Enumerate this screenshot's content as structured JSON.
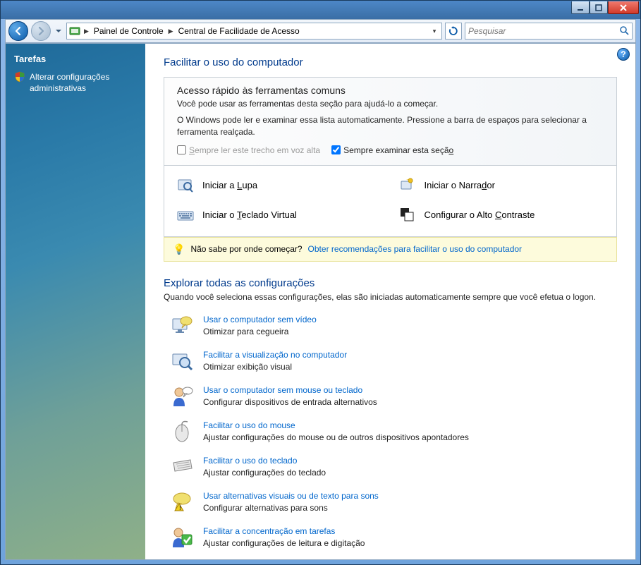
{
  "window": {
    "min_tip": "Minimizar",
    "max_tip": "Maximizar",
    "close_tip": "Fechar"
  },
  "nav": {
    "breadcrumb": {
      "root": "Painel de Controle",
      "current": "Central de Facilidade de Acesso"
    },
    "search_placeholder": "Pesquisar"
  },
  "sidebar": {
    "tasks_header": "Tarefas",
    "task1": "Alterar configurações administrativas"
  },
  "page": {
    "title": "Facilitar o uso do computador",
    "quick": {
      "title": "Acesso rápido às ferramentas comuns",
      "sub": "Você pode usar as ferramentas desta seção para ajudá-lo a começar.",
      "note": "O Windows pode ler e examinar essa lista automaticamente. Pressione a barra de espaços para selecionar a ferramenta realçada.",
      "chk_read_html": "<u>S</u>empre ler este trecho em voz alta",
      "chk_scan_html": "Sempre examinar esta seçã<u>o</u>"
    },
    "tools": {
      "magnifier_html": "Iniciar a <u>L</u>upa",
      "narrator_html": "Iniciar o Narra<u>d</u>or",
      "osk_html": "Iniciar o <u>T</u>eclado Virtual",
      "contrast_html": "Configurar o Alto <u>C</u>ontraste"
    },
    "hint": {
      "prefix": "Não sabe por onde começar?",
      "link": "Obter recomendações para facilitar o uso do computador"
    },
    "explore": {
      "title": "Explorar todas as configurações",
      "sub": "Quando você seleciona essas configurações, elas são iniciadas automaticamente sempre que você efetua o logon."
    },
    "settings": [
      {
        "link": "Usar o computador sem vídeo",
        "desc": "Otimizar para cegueira"
      },
      {
        "link": "Facilitar a visualização no computador",
        "desc": "Otimizar exibição visual"
      },
      {
        "link": "Usar o computador sem mouse ou teclado",
        "desc": "Configurar dispositivos de entrada alternativos"
      },
      {
        "link": "Facilitar o uso do mouse",
        "desc": "Ajustar configurações do mouse ou de outros dispositivos apontadores"
      },
      {
        "link": "Facilitar o uso do teclado",
        "desc": "Ajustar configurações do teclado"
      },
      {
        "link": "Usar alternativas visuais ou de texto para sons",
        "desc": "Configurar alternativas para sons"
      },
      {
        "link": "Facilitar a concentração em tarefas",
        "desc": "Ajustar configurações de leitura e digitação"
      }
    ]
  }
}
